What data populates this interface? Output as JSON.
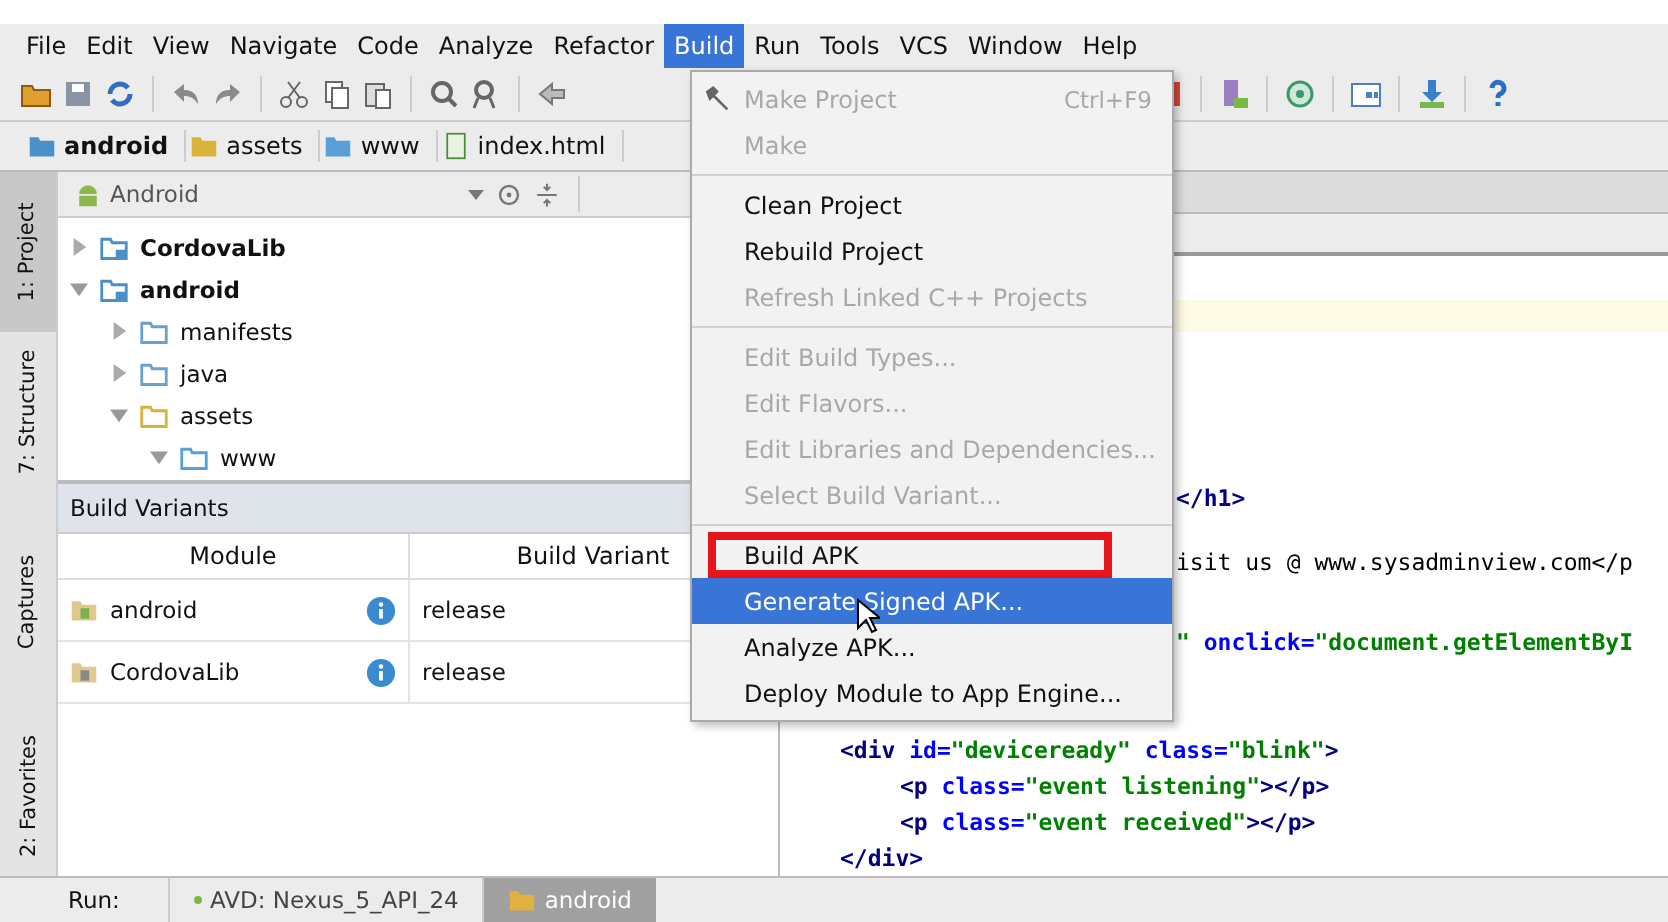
{
  "menu_bar": [
    {
      "label": "File",
      "selected": false
    },
    {
      "label": "Edit",
      "selected": false
    },
    {
      "label": "View",
      "selected": false
    },
    {
      "label": "Navigate",
      "selected": false
    },
    {
      "label": "Code",
      "selected": false
    },
    {
      "label": "Analyze",
      "selected": false
    },
    {
      "label": "Refactor",
      "selected": false
    },
    {
      "label": "Build",
      "selected": true
    },
    {
      "label": "Run",
      "selected": false
    },
    {
      "label": "Tools",
      "selected": false
    },
    {
      "label": "VCS",
      "selected": false
    },
    {
      "label": "Window",
      "selected": false
    },
    {
      "label": "Help",
      "selected": false
    }
  ],
  "breadcrumb": [
    {
      "label": "android",
      "kind": "module"
    },
    {
      "label": "assets",
      "kind": "assets"
    },
    {
      "label": "www",
      "kind": "web"
    },
    {
      "label": "index.html",
      "kind": "file"
    }
  ],
  "tool_strip": [
    {
      "label": "1: Project",
      "selected": true
    },
    {
      "label": "7: Structure",
      "selected": false
    },
    {
      "label": "Captures",
      "selected": false
    },
    {
      "label": "2: Favorites",
      "selected": false
    }
  ],
  "project_panel": {
    "view": "Android",
    "tree": [
      {
        "label": "CordovaLib",
        "kind": "module",
        "expanded": false
      },
      {
        "label": "android",
        "kind": "module",
        "expanded": true,
        "children": [
          {
            "label": "manifests",
            "kind": "folder",
            "expanded": false
          },
          {
            "label": "java",
            "kind": "folder",
            "expanded": false
          },
          {
            "label": "assets",
            "kind": "assets",
            "expanded": true,
            "children": [
              {
                "label": "www",
                "kind": "web",
                "expanded": true
              }
            ]
          }
        ]
      }
    ]
  },
  "build_variants": {
    "title": "Build Variants",
    "columns": [
      "Module",
      "Build Variant"
    ],
    "rows": [
      {
        "module": "android",
        "kind": "app",
        "variant": "release"
      },
      {
        "module": "CordovaLib",
        "kind": "library",
        "variant": "release"
      }
    ]
  },
  "build_menu": [
    {
      "kind": "item",
      "label": "Make Project",
      "shortcut": "Ctrl+F9",
      "disabled": true,
      "selected": false,
      "highlighted": false,
      "icon": true
    },
    {
      "kind": "item",
      "label": "Make",
      "disabled": true,
      "selected": false,
      "highlighted": false
    },
    {
      "kind": "separator"
    },
    {
      "kind": "item",
      "label": "Clean Project",
      "disabled": false,
      "selected": false,
      "highlighted": false
    },
    {
      "kind": "item",
      "label": "Rebuild Project",
      "disabled": false,
      "selected": false,
      "highlighted": false
    },
    {
      "kind": "item",
      "label": "Refresh Linked C++ Projects",
      "disabled": true,
      "selected": false,
      "highlighted": false
    },
    {
      "kind": "separator"
    },
    {
      "kind": "item",
      "label": "Edit Build Types...",
      "disabled": true,
      "selected": false,
      "highlighted": false
    },
    {
      "kind": "item",
      "label": "Edit Flavors...",
      "disabled": true,
      "selected": false,
      "highlighted": false
    },
    {
      "kind": "item",
      "label": "Edit Libraries and Dependencies...",
      "disabled": true,
      "selected": false,
      "highlighted": false
    },
    {
      "kind": "item",
      "label": "Select Build Variant...",
      "disabled": true,
      "selected": false,
      "highlighted": false
    },
    {
      "kind": "separator"
    },
    {
      "kind": "item",
      "label": "Build APK",
      "disabled": false,
      "selected": false,
      "highlighted": true
    },
    {
      "kind": "item",
      "label": "Generate Signed APK...",
      "disabled": false,
      "selected": true,
      "highlighted": false
    },
    {
      "kind": "item",
      "label": "Analyze APK...",
      "disabled": false,
      "selected": false,
      "highlighted": false
    },
    {
      "kind": "item",
      "label": "Deploy Module to App Engine...",
      "disabled": false,
      "selected": false,
      "highlighted": false
    }
  ],
  "editor_lines": [
    {
      "kind": "clipped",
      "tokens": [
        {
          "kind": "tag",
          "text": "</h1>"
        }
      ]
    },
    {
      "kind": "clipped",
      "tokens": [
        {
          "kind": "text",
          "text": "isit us @ www.sysadminview.com</p"
        }
      ]
    },
    {
      "kind": "clipped",
      "tokens": [
        {
          "kind": "string",
          "text": "\""
        },
        {
          "kind": "attr",
          "text": " onclick="
        },
        {
          "kind": "string",
          "text": "\"document.getElementByI"
        }
      ]
    },
    {
      "kind": "full",
      "tokens": [
        {
          "kind": "tag",
          "text": "<div"
        },
        {
          "kind": "attr",
          "text": " id="
        },
        {
          "kind": "string",
          "text": "\"deviceready\""
        },
        {
          "kind": "attr",
          "text": " class="
        },
        {
          "kind": "string",
          "text": "\"blink\""
        },
        {
          "kind": "tag",
          "text": ">"
        }
      ]
    },
    {
      "kind": "nested",
      "tokens": [
        {
          "kind": "tag",
          "text": "<p"
        },
        {
          "kind": "attr",
          "text": " class="
        },
        {
          "kind": "string",
          "text": "\"event listening\""
        },
        {
          "kind": "tag",
          "text": "></p>"
        }
      ]
    },
    {
      "kind": "nested",
      "tokens": [
        {
          "kind": "tag",
          "text": "<p"
        },
        {
          "kind": "attr",
          "text": " class="
        },
        {
          "kind": "string",
          "text": "\"event received\""
        },
        {
          "kind": "tag",
          "text": "></p>"
        }
      ]
    },
    {
      "kind": "full",
      "tokens": [
        {
          "kind": "tag",
          "text": "</div>"
        }
      ]
    }
  ],
  "run_bar": {
    "label": "Run:",
    "tabs": [
      {
        "label": "AVD: Nexus_5_API_24",
        "selected": false
      },
      {
        "label": "android",
        "selected": true
      }
    ]
  }
}
